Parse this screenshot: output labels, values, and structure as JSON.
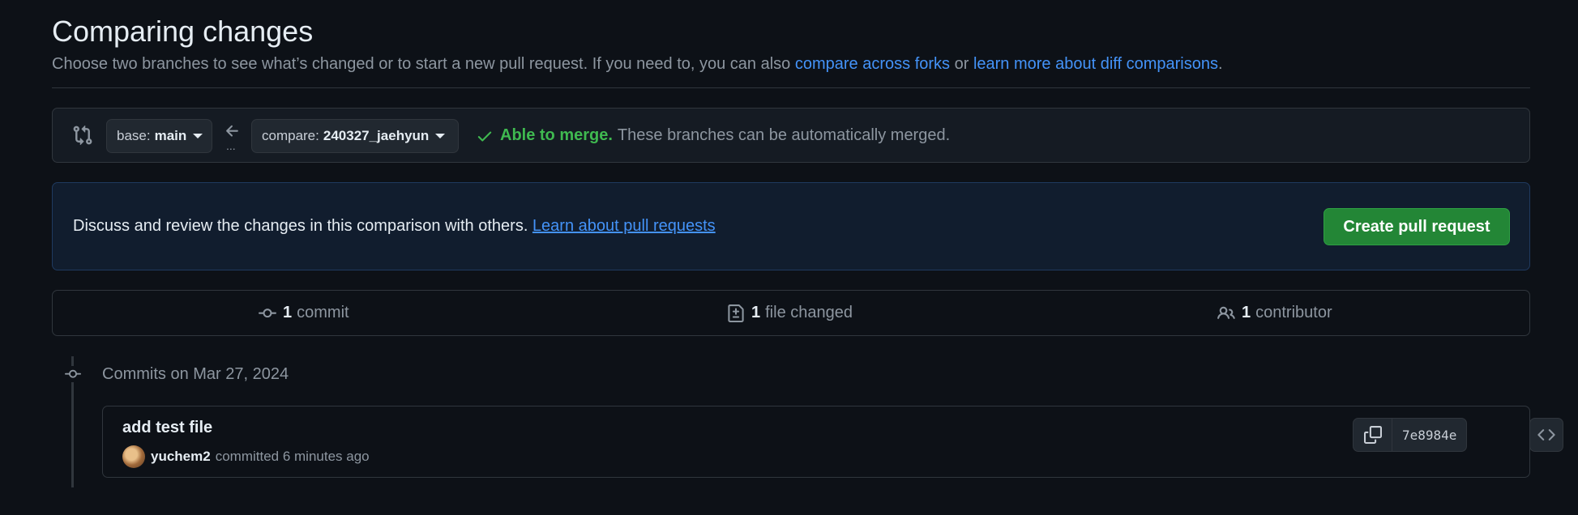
{
  "header": {
    "title": "Comparing changes",
    "subtitle_prefix": "Choose two branches to see what’s changed or to start a new pull request. If you need to, you can also ",
    "compare_forks_link": "compare across forks",
    "subtitle_or": " or ",
    "learn_diff_link": "learn more about diff comparisons",
    "subtitle_suffix": "."
  },
  "range": {
    "base_prefix": "base:",
    "base_branch": "main",
    "compare_prefix": "compare:",
    "compare_branch": "240327_jaehyun",
    "dots": "...",
    "merge_ok": "Able to merge.",
    "merge_msg": "These branches can be automatically merged."
  },
  "banner": {
    "text": "Discuss and review the changes in this comparison with others. ",
    "link": "Learn about pull requests",
    "button": "Create pull request"
  },
  "stats": {
    "commits_count": "1",
    "commits_label": "commit",
    "files_count": "1",
    "files_label": "file changed",
    "contributors_count": "1",
    "contributors_label": "contributor"
  },
  "commits": {
    "date_heading": "Commits on Mar 27, 2024",
    "items": [
      {
        "message": "add test file",
        "author": "yuchem2",
        "action": "committed 6 minutes ago",
        "sha": "7e8984e"
      }
    ]
  },
  "colors": {
    "background": "#0d1117",
    "accent_link": "#4493f8",
    "success": "#3fb950",
    "primary_button": "#238636"
  },
  "icons": [
    "git-compare-icon",
    "arrow-left-icon",
    "check-icon",
    "git-commit-icon",
    "file-diff-icon",
    "people-icon",
    "copy-icon",
    "code-icon"
  ]
}
